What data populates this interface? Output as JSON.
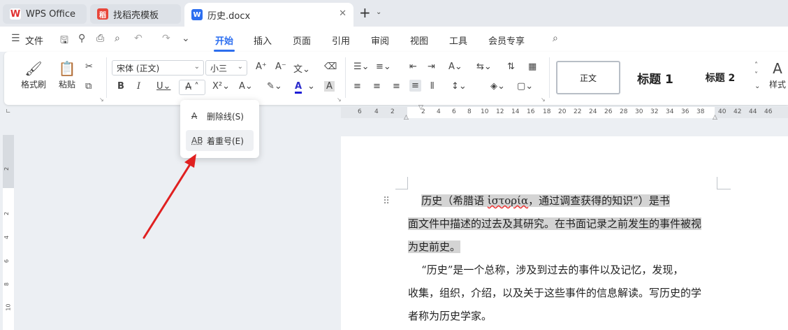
{
  "tabs": {
    "wps": {
      "label": "WPS Office",
      "logo": "W"
    },
    "shell": {
      "label": "找稻壳模板",
      "logo": "稻"
    },
    "doc": {
      "label": "历史.docx",
      "logo": "W"
    }
  },
  "menu": {
    "file": "文件",
    "items": [
      "开始",
      "插入",
      "页面",
      "引用",
      "审阅",
      "视图",
      "工具",
      "会员专享"
    ],
    "active_index": 0
  },
  "ribbon": {
    "format_painter": "格式刷",
    "paste": "粘贴",
    "font_name": "宋体 (正文)",
    "font_size": "小三",
    "styles": {
      "normal": "正文",
      "h1": "标题 1",
      "h2": "标题 2",
      "more": "样式"
    }
  },
  "dropdown": {
    "strikethrough": "删除线(S)",
    "emphasis": "着重号(E)",
    "strike_icon": "A",
    "emph_icon": "AB"
  },
  "ruler": {
    "top": [
      "6",
      "4",
      "2",
      "2",
      "4",
      "6",
      "8",
      "10",
      "12",
      "14",
      "16",
      "18",
      "20",
      "22",
      "24",
      "26",
      "28",
      "30",
      "32",
      "34",
      "36",
      "38",
      "40",
      "42",
      "44",
      "46"
    ],
    "left": [
      "2",
      "2",
      "4",
      "6",
      "8",
      "10"
    ]
  },
  "document": {
    "p1_a": "历史（希腊语 ",
    "p1_greek": "ἱστορία",
    "p1_b": "，通过调查获得的知识”）是书",
    "p1_line2": "面文件中描述的过去及其研究。在书面记录之前发生的事件被视",
    "p1_line3": "为史前史。",
    "p2_line1": "“历史”是一个总称，涉及到过去的事件以及记忆，发现，",
    "p2_line2": "收集，组织，介绍，以及关于这些事件的信息解读。写历史的学",
    "p2_line3": "者称为历史学家。"
  },
  "colors": {
    "accent": "#2d6ff0",
    "arrow": "#e02020",
    "highlight": "#d4d4d4"
  }
}
